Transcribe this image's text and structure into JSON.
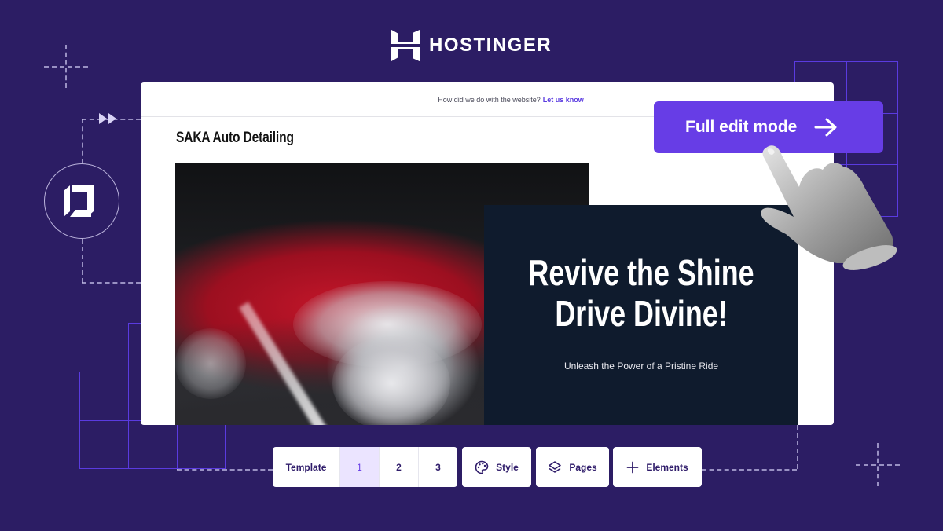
{
  "brand": {
    "name": "HOSTINGER",
    "accent_color": "#673de6",
    "background_color": "#2c1d64"
  },
  "preview": {
    "feedback_text": "How did we do with the website?",
    "feedback_link": "Let us know",
    "site_title": "SAKA Auto Detailing",
    "hero": {
      "headline_line1": "Revive the Shine",
      "headline_line2": "Drive Divine!",
      "subheadline": "Unleash the Power of a Pristine Ride",
      "image_icon": "car-wash-photo",
      "panel_color": "#0f1b2d"
    }
  },
  "edit_button": {
    "label": "Full edit mode",
    "icon": "arrow-right-icon"
  },
  "toolbar": {
    "template_label": "Template",
    "templates": [
      {
        "label": "1",
        "active": true
      },
      {
        "label": "2",
        "active": false
      },
      {
        "label": "3",
        "active": false
      }
    ],
    "style_label": "Style",
    "style_icon": "palette-icon",
    "pages_label": "Pages",
    "pages_icon": "layers-icon",
    "elements_label": "Elements",
    "elements_icon": "plus-icon"
  }
}
